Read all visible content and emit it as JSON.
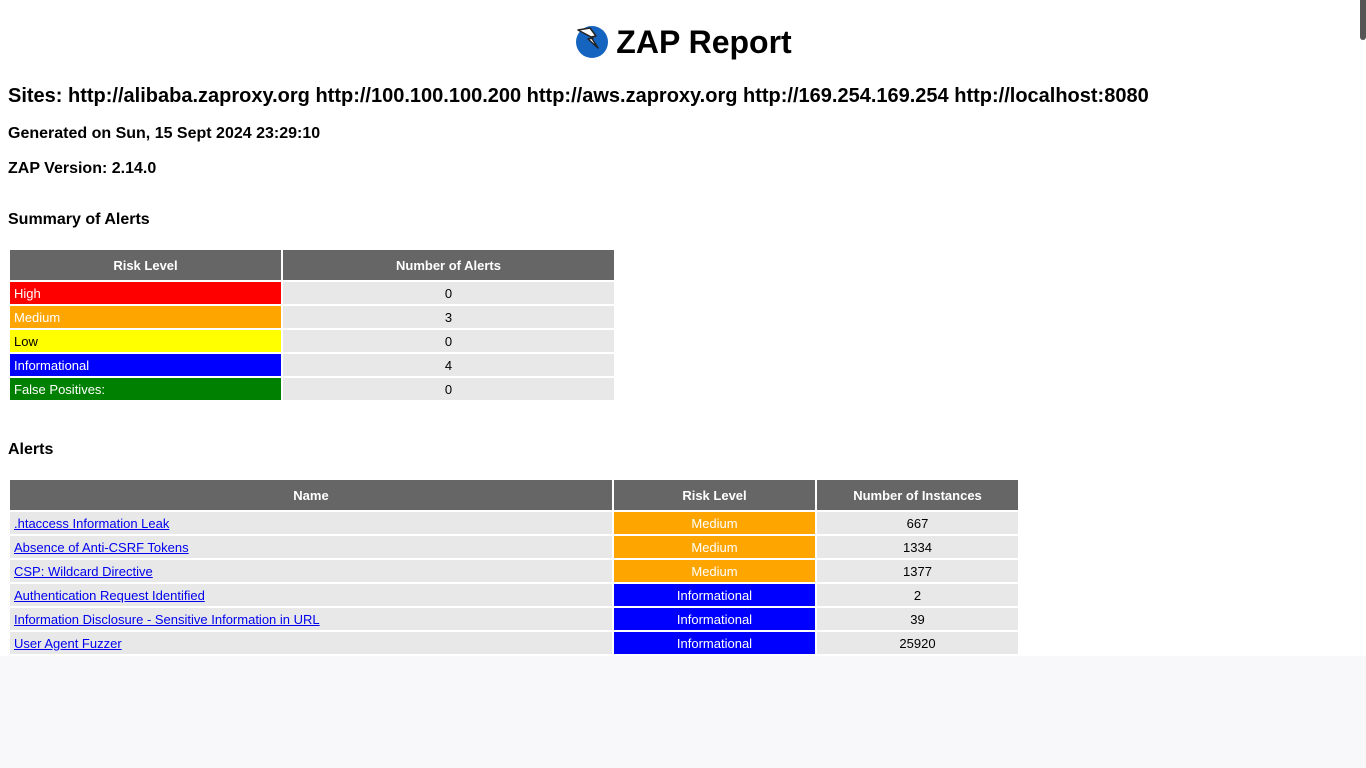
{
  "report": {
    "title": "ZAP Report",
    "sites": "Sites: http://alibaba.zaproxy.org http://100.100.100.200 http://aws.zaproxy.org http://169.254.169.254 http://localhost:8080",
    "generated": "Generated on Sun, 15 Sept 2024 23:29:10",
    "version": "ZAP Version: 2.14.0"
  },
  "summary": {
    "heading": "Summary of Alerts",
    "col_risk": "Risk Level",
    "col_count": "Number of Alerts",
    "rows": [
      {
        "label": "High",
        "count": "0",
        "color": "#ff0000"
      },
      {
        "label": "Medium",
        "count": "3",
        "color": "#ffa500"
      },
      {
        "label": "Low",
        "count": "0",
        "color": "#ffff00"
      },
      {
        "label": "Informational",
        "count": "4",
        "color": "#0000ff"
      },
      {
        "label": "False Positives:",
        "count": "0",
        "color": "#008000"
      }
    ]
  },
  "alerts": {
    "heading": "Alerts",
    "col_name": "Name",
    "col_risk": "Risk Level",
    "col_instances": "Number of Instances",
    "rows": [
      {
        "name": ".htaccess Information Leak",
        "risk": "Medium",
        "instances": "667"
      },
      {
        "name": "Absence of Anti-CSRF Tokens",
        "risk": "Medium",
        "instances": "1334"
      },
      {
        "name": "CSP: Wildcard Directive",
        "risk": "Medium",
        "instances": "1377"
      },
      {
        "name": "Authentication Request Identified",
        "risk": "Informational",
        "instances": "2"
      },
      {
        "name": "Information Disclosure - Sensitive Information in URL",
        "risk": "Informational",
        "instances": "39"
      },
      {
        "name": "User Agent Fuzzer",
        "risk": "Informational",
        "instances": "25920"
      },
      {
        "name": "",
        "risk": "",
        "instances": ""
      }
    ]
  }
}
